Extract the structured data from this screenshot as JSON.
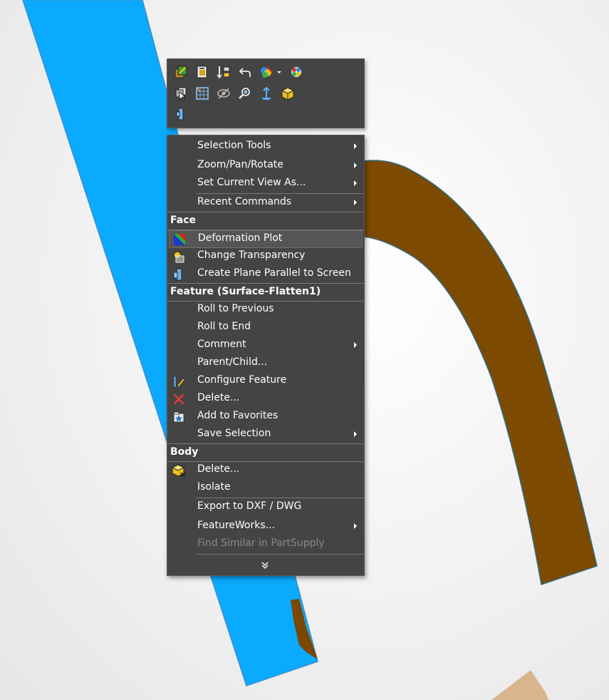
{
  "colors": {
    "menu_bg": "#444444",
    "surface_blue": "#0aaaff",
    "surface_brown": "#7a4800",
    "surface_tan": "#d9b58e"
  },
  "toolbar": {
    "buttons": [
      {
        "name": "edit-sketch-icon"
      },
      {
        "name": "edit-feature-icon"
      },
      {
        "name": "rollback-icon"
      },
      {
        "name": "undo-icon"
      },
      {
        "name": "appearance-icon"
      },
      {
        "name": "dropdown-arrow-icon"
      },
      {
        "name": "edit-color-icon"
      },
      {
        "name": "select-other-icon"
      },
      {
        "name": "sketch-grid-icon"
      },
      {
        "name": "hide-icon"
      },
      {
        "name": "zoom-to-selection-icon"
      },
      {
        "name": "normal-to-icon"
      },
      {
        "name": "isometric-view-icon"
      },
      {
        "name": "section-view-icon"
      }
    ]
  },
  "menu": {
    "view_items": [
      {
        "label": "Selection Tools",
        "submenu": true
      },
      {
        "label": "Zoom/Pan/Rotate",
        "submenu": true
      },
      {
        "label": "Set Current View As...",
        "submenu": true
      },
      {
        "label": "Recent Commands",
        "submenu": true
      }
    ],
    "face_section": {
      "title": "Face",
      "items": [
        {
          "label": "Deformation Plot",
          "icon": "deformation-plot-icon"
        },
        {
          "label": "Change Transparency",
          "icon": "transparency-icon"
        },
        {
          "label": "Create Plane Parallel to Screen",
          "icon": "plane-parallel-icon"
        }
      ]
    },
    "feature_section": {
      "title": "Feature (Surface-Flatten1)",
      "items": [
        {
          "label": "Roll to Previous"
        },
        {
          "label": "Roll to End"
        },
        {
          "label": "Comment",
          "submenu": true
        },
        {
          "label": "Parent/Child..."
        },
        {
          "label": "Configure Feature",
          "icon": "configure-feature-icon"
        },
        {
          "label": "Delete...",
          "icon": "delete-icon"
        },
        {
          "label": "Add to Favorites",
          "icon": "favorites-icon"
        },
        {
          "label": "Save Selection",
          "submenu": true
        }
      ]
    },
    "body_section": {
      "title": "Body",
      "items": [
        {
          "label": "Delete...",
          "icon": "delete-body-icon"
        },
        {
          "label": "Isolate"
        },
        {
          "label": "Export to DXF / DWG"
        },
        {
          "label": "FeatureWorks...",
          "submenu": true
        },
        {
          "label": "Find Similar in PartSupply",
          "disabled": true
        }
      ]
    },
    "expand_icon": "double-chevron-down-icon"
  }
}
